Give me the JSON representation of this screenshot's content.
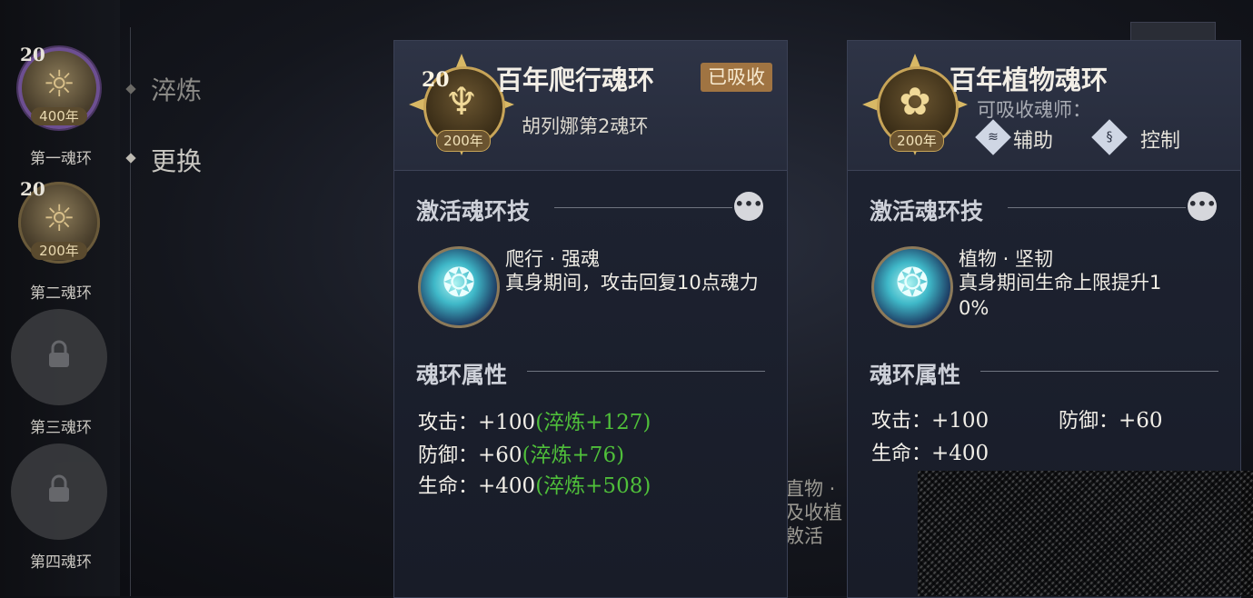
{
  "sidebar": {
    "rings": [
      {
        "name": "第一魂环",
        "level": "20",
        "years": "400年",
        "glyph": "☼"
      },
      {
        "name": "第二魂环",
        "level": "20",
        "years": "200年",
        "glyph": "☼"
      },
      {
        "name": "第三魂环",
        "locked": true
      },
      {
        "name": "第四魂环",
        "locked": true
      }
    ]
  },
  "nav": {
    "items": [
      {
        "label": "淬炼"
      },
      {
        "label": "更换"
      }
    ]
  },
  "cards": [
    {
      "level": "20",
      "years": "200年",
      "glyph": "♆",
      "title": "百年爬行魂环",
      "badge": "已吸收",
      "subtitle": "胡列娜第2魂环",
      "skill_section": "激活魂环技",
      "skill_name": "爬行 · 强魂",
      "skill_desc": "真身期间，攻击回复10点魂力",
      "attr_section": "魂环属性",
      "stats": [
        {
          "label": "攻击：",
          "value": "+100",
          "bonus": "(淬炼+127)"
        },
        {
          "label": "防御：",
          "value": "+60",
          "bonus": "(淬炼+76)"
        },
        {
          "label": "生命：",
          "value": "+400",
          "bonus": "(淬炼+508)"
        }
      ]
    },
    {
      "years": "200年",
      "glyph": "✿",
      "title": "百年植物魂环",
      "absorber_label": "可吸收魂师：",
      "roles": [
        "辅助",
        "控制"
      ],
      "skill_section": "激活魂环技",
      "skill_name": "植物 · 坚韧",
      "skill_desc_line1": "真身期间生命上限提升1",
      "skill_desc_line2": "0%",
      "attr_section": "魂环属性",
      "stats": [
        {
          "label": "攻击：",
          "value": "+100"
        },
        {
          "label": "防御：",
          "value": "+60"
        },
        {
          "label": "生命：",
          "value": "+400"
        }
      ]
    }
  ],
  "background_text": [
    "直物 ·",
    "及收植",
    "敫活"
  ],
  "more_label": "•••"
}
